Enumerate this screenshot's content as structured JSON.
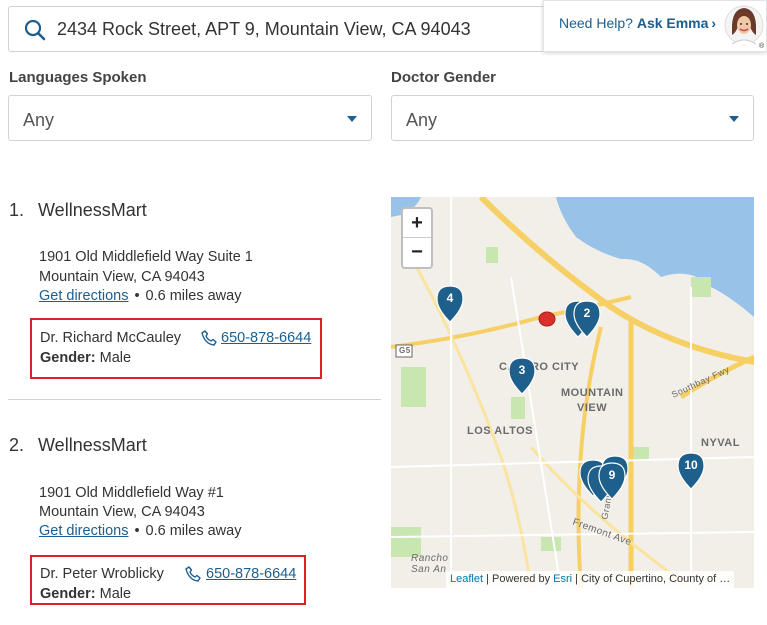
{
  "search": {
    "value": "2434 Rock Street, APT 9, Mountain View, CA 94043"
  },
  "help": {
    "prefix": "Need Help?",
    "name": "Ask Emma",
    "chevron": "›"
  },
  "filters": {
    "languages": {
      "label": "Languages Spoken",
      "value": "Any"
    },
    "gender": {
      "label": "Doctor Gender",
      "value": "Any"
    }
  },
  "results": [
    {
      "num": "1.",
      "name": "WellnessMart",
      "address1": "1901 Old Middlefield Way Suite 1",
      "address2": "Mountain View, CA 94043",
      "directions": "Get directions",
      "distance": "0.6 miles away",
      "doctor": "Dr. Richard McCauley",
      "phone": "650-878-6644",
      "gender_label": "Gender:",
      "gender": "Male"
    },
    {
      "num": "2.",
      "name": "WellnessMart",
      "address1": "1901 Old Middlefield Way #1",
      "address2": "Mountain View, CA 94043",
      "directions": "Get directions",
      "distance": "0.6 miles away",
      "doctor": "Dr. Peter Wroblicky",
      "phone": "650-878-6644",
      "gender_label": "Gender:",
      "gender": "Male"
    }
  ],
  "map": {
    "zoom_in": "+",
    "zoom_out": "−",
    "labels": {
      "castro_city": "CASTRO CITY",
      "mountain": "MOUNTAIN",
      "view": "VIEW",
      "los_altos": "LOS ALTOS",
      "sunnyvale": "NYVAL",
      "southbay": "Southbay Fwy",
      "fremont": "Fremont Ave",
      "grant": "Grant",
      "rancho": "Rancho",
      "san_an": "San An",
      "g5": "G5"
    },
    "markers": [
      "4",
      "2",
      "3",
      "9",
      "10"
    ],
    "attribution": {
      "leaflet": "Leaflet",
      "sep": " | Powered by ",
      "esri": "Esri",
      "rest": " | City of Cupertino, County of …"
    }
  },
  "colors": {
    "accent": "#1b5e8f",
    "highlight": "#e01f26",
    "marker": "#1f5f8b"
  }
}
